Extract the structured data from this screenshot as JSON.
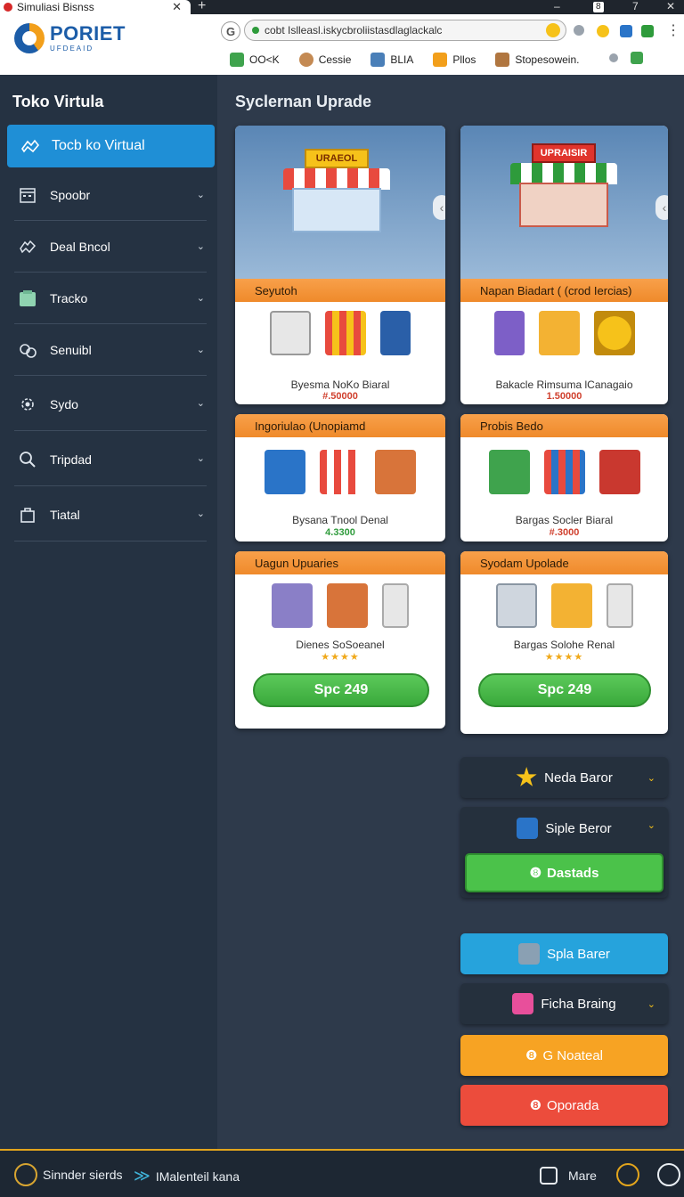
{
  "browser": {
    "tab_title": "Simuliasi Bisnss",
    "tab_close": "✕",
    "new_tab": "+",
    "win_min": "–",
    "win_num": "7",
    "win_close": "✕",
    "back": "G",
    "url": "cobt Islleasl.iskycbroliistasdlaglackalc",
    "bookmarks": [
      "OO<K",
      "Cessie",
      "BLIA",
      "Pllos",
      "Stopesowein."
    ]
  },
  "logo": {
    "line1": "PORIET",
    "line2": "UFDEAID"
  },
  "sidebar": {
    "title": "Toko Virtula",
    "active": "Tocb ko Virtual",
    "items": [
      {
        "label": "Spoobr",
        "icon": "calendar-icon"
      },
      {
        "label": "Deal Bncol",
        "icon": "handshake-icon"
      },
      {
        "label": "Tracko",
        "icon": "box-icon"
      },
      {
        "label": "Senuibl",
        "icon": "settings-icon"
      },
      {
        "label": "Sydo",
        "icon": "gear-icon"
      },
      {
        "label": "Tripdad",
        "icon": "search-icon"
      },
      {
        "label": "Tiatal",
        "icon": "bag-icon"
      }
    ],
    "chevron": "⌄"
  },
  "main": {
    "title": "Syclernan Uprade",
    "hero_signs": [
      "URAEOL",
      "UPRAISIR"
    ],
    "cards": [
      {
        "head": "Seyutoh",
        "sub": "Byesma NoKo Biaral",
        "price": "#.50000"
      },
      {
        "head": "Napan Biadart ( (crod Iercias)",
        "sub": "Bakacle Rimsuma lCanagaio",
        "price": "1.50000"
      },
      {
        "head": "Ingoriulao (Unopiamd",
        "sub": "Bysana Tnool Denal",
        "price": "4.3300"
      },
      {
        "head": "Probis Bedo",
        "sub": "Bargas Socler Biaral",
        "price": "#.3000"
      },
      {
        "head": "Uagun Upuaries",
        "sub": "Dienes SoSoeanel",
        "stars": "★★★★",
        "button": "Spc 249"
      },
      {
        "head": "Syodam Upolade",
        "sub": "Bargas Solohe Renal",
        "stars": "★★★★",
        "button": "Spc 249"
      }
    ],
    "arrow": "‹"
  },
  "panel": {
    "neda": "Neda Baror",
    "siple": "Siple Beror",
    "dastads": "Dastads",
    "spla": "Spla Barer",
    "ficha": "Ficha Braing",
    "noateal": "G Noateal",
    "oporada": "Oporada"
  },
  "bottom": {
    "left": "Sinnder sierds",
    "mid": "IMalenteil kana",
    "more": "Mare"
  },
  "colors": {
    "accent_blue": "#1f8fd6",
    "orange_head": "#f29a3c",
    "green_button": "#4bc24a",
    "sidebar_bg": "#253242",
    "main_bg": "#2e3a4b"
  }
}
